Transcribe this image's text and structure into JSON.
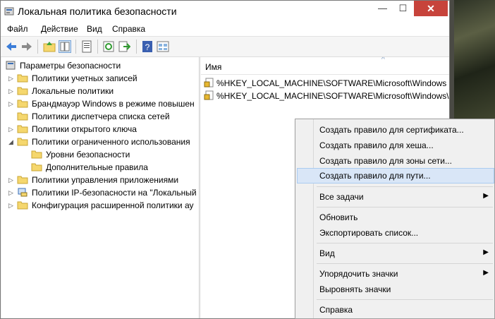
{
  "window": {
    "title": "Локальная политика безопасности",
    "minimize": "—",
    "maximize": "☐",
    "close": "✕"
  },
  "menu": [
    "Файл",
    "Действие",
    "Вид",
    "Справка"
  ],
  "toolbar": [
    "back-icon",
    "forward-icon",
    "up-folder-icon",
    "show-tree-icon",
    "properties-icon",
    "refresh-icon",
    "export-icon",
    "help-icon",
    "view-icon"
  ],
  "tree": {
    "root": "Параметры безопасности",
    "items": [
      {
        "label": "Политики учетных записей",
        "expand": "▷"
      },
      {
        "label": "Локальные политики",
        "expand": "▷"
      },
      {
        "label": "Брандмауэр Windows в режиме повышен",
        "expand": "▷"
      },
      {
        "label": "Политики диспетчера списка сетей",
        "expand": ""
      },
      {
        "label": "Политики открытого ключа",
        "expand": "▷"
      },
      {
        "label": "Политики ограниченного использования",
        "expand": "◢"
      },
      {
        "label": "Уровни безопасности",
        "expand": ""
      },
      {
        "label": "Дополнительные правила",
        "expand": ""
      },
      {
        "label": "Политики управления приложениями",
        "expand": "▷"
      },
      {
        "label": "Политики IP-безопасности на \"Локальный",
        "expand": "▷"
      },
      {
        "label": "Конфигурация расширенной политики ау",
        "expand": "▷"
      }
    ]
  },
  "list": {
    "column": "Имя",
    "sort_indicator": "^",
    "rows": [
      "%HKEY_LOCAL_MACHINE\\SOFTWARE\\Microsoft\\Windows N",
      "%HKEY_LOCAL_MACHINE\\SOFTWARE\\Microsoft\\Windows\\C"
    ]
  },
  "context_menu": {
    "items": [
      {
        "label": "Создать правило для сертификата...",
        "arrow": ""
      },
      {
        "label": "Создать правило для хеша...",
        "arrow": ""
      },
      {
        "label": "Создать правило для зоны сети...",
        "arrow": ""
      },
      {
        "label": "Создать правило для пути...",
        "arrow": ""
      },
      {
        "label": "Все задачи",
        "arrow": "▶"
      },
      {
        "label": "Обновить",
        "arrow": ""
      },
      {
        "label": "Экспортировать список...",
        "arrow": ""
      },
      {
        "label": "Вид",
        "arrow": "▶"
      },
      {
        "label": "Упорядочить значки",
        "arrow": "▶"
      },
      {
        "label": "Выровнять значки",
        "arrow": ""
      },
      {
        "label": "Справка",
        "arrow": ""
      }
    ],
    "highlighted_index": 3
  },
  "colors": {
    "accent": "#d9e6f7",
    "close_button": "#c7433b",
    "folder": "#f5d76e"
  }
}
